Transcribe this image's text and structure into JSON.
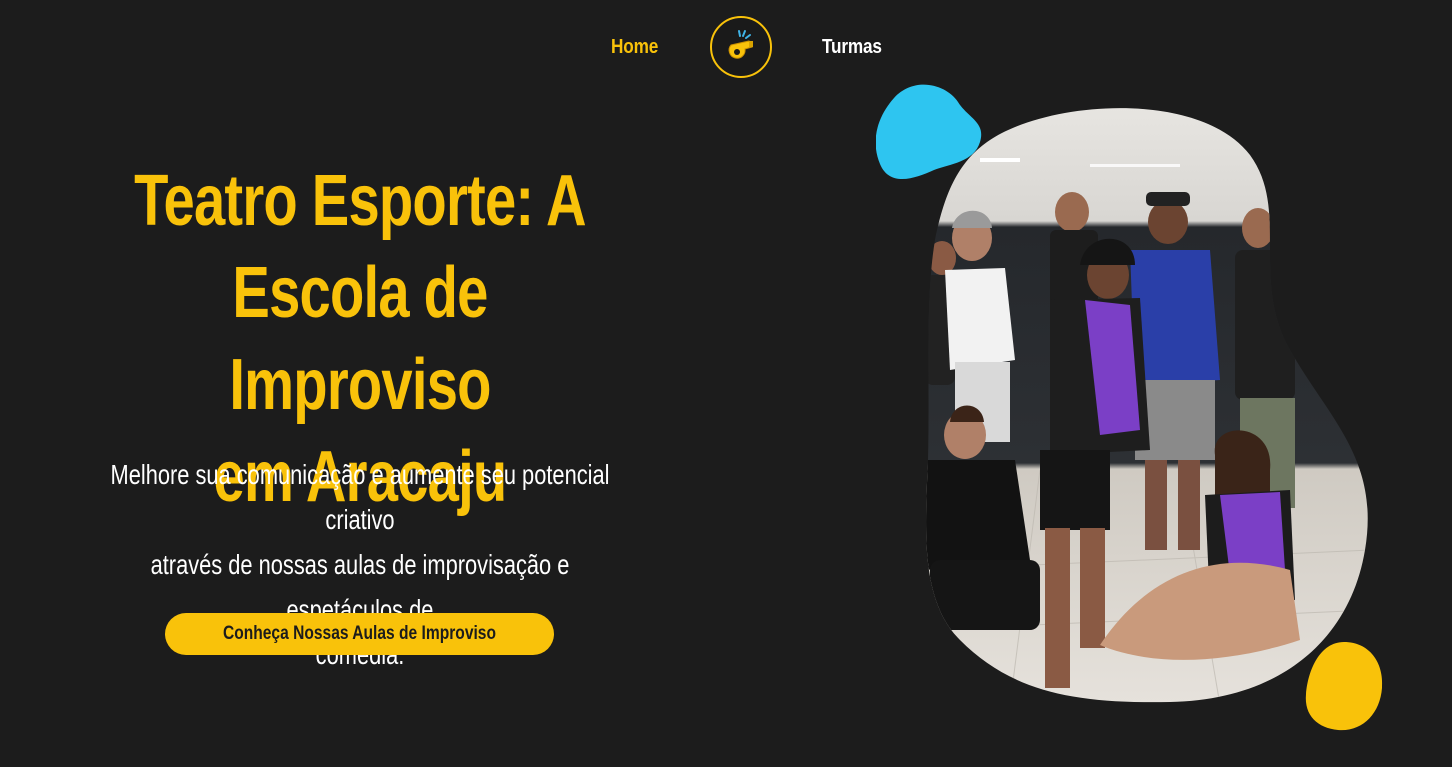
{
  "nav": {
    "home_label": "Home",
    "turmas_label": "Turmas",
    "logo_icon": "whistle-icon"
  },
  "hero": {
    "title_line1": "Teatro Esporte: A",
    "title_line2": "Escola de Improviso",
    "title_line3": "em Aracaju",
    "subtitle_line1": "Melhore sua comunicação e aumente seu potencial criativo",
    "subtitle_line2": "através de nossas aulas de improvisação e espetáculos de",
    "subtitle_line3": "comédia.",
    "cta_label": "Conheça Nossas Aulas de Improviso"
  },
  "colors": {
    "background": "#1c1c1c",
    "accent": "#f9c20a",
    "blob_blue": "#2ec5f0",
    "text": "#ffffff"
  }
}
